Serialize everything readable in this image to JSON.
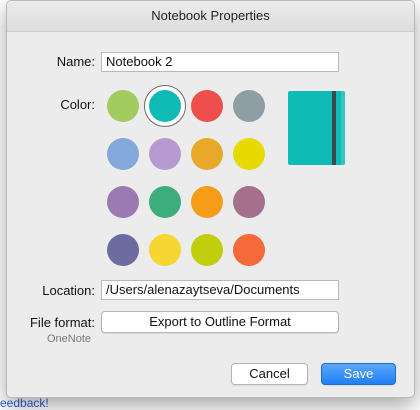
{
  "background": {
    "link_text": "eedback!"
  },
  "dialog": {
    "title": "Notebook Properties",
    "name_label": "Name:",
    "name_value": "Notebook 2",
    "color_label": "Color:",
    "colors": [
      "#a3cc5e",
      "#11bbb5",
      "#ee4e4c",
      "#8e9ea4",
      "#84a8da",
      "#b89ad3",
      "#e8a92a",
      "#e6da00",
      "#9b7ab4",
      "#3ead7e",
      "#f59d19",
      "#a4708e",
      "#6d6ca0",
      "#f6d731",
      "#c1ce0c",
      "#f56a38"
    ],
    "selected_color_index": 1,
    "selected_color": "#11bbb5",
    "location_label": "Location:",
    "location_value": "/Users/alenazaytseva/Documents",
    "file_format_label": "File format:",
    "file_format_sublabel": "OneNote",
    "export_button_label": "Export to Outline Format",
    "cancel_label": "Cancel",
    "save_label": "Save"
  }
}
